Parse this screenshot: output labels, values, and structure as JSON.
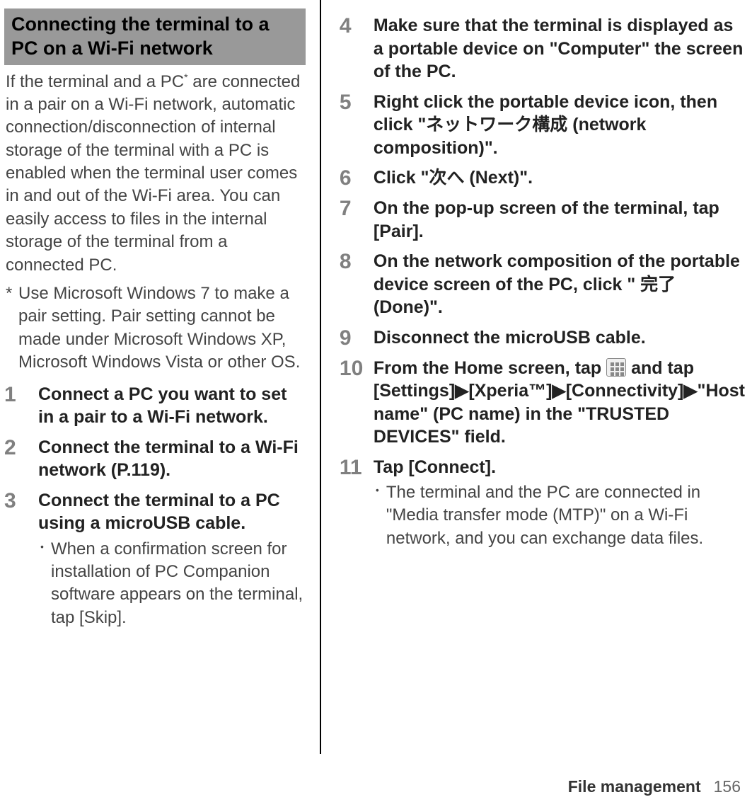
{
  "header": {
    "title": "Connecting the terminal to a PC on a Wi-Fi network"
  },
  "intro": {
    "text_before_ast": "If the terminal and a PC",
    "text_after_ast": " are connected in a pair on a Wi-Fi network, automatic connection/disconnection of internal storage of the terminal with a PC is enabled when the terminal user comes in and out of the Wi-Fi area. You can easily access to files in the internal storage of the terminal from a connected PC."
  },
  "footnote": {
    "marker": "*",
    "text": "Use Microsoft Windows 7 to make a pair setting. Pair setting cannot be made under Microsoft Windows XP, Microsoft Windows Vista or other OS."
  },
  "steps": [
    {
      "num": "1",
      "title": "Connect a PC you want to set in a pair to a Wi-Fi network."
    },
    {
      "num": "2",
      "title": "Connect the terminal to a Wi-Fi network (P.119)."
    },
    {
      "num": "3",
      "title": "Connect the terminal to a PC using a microUSB cable.",
      "sub": "When a confirmation screen for installation of PC Companion software appears on the terminal, tap [Skip]."
    },
    {
      "num": "4",
      "title": "Make sure that the terminal is displayed as a portable device on \"Computer\" the screen of the PC."
    },
    {
      "num": "5",
      "title": "Right click the portable device icon, then click \"ネットワーク構成 (network composition)\"."
    },
    {
      "num": "6",
      "title": "Click \"次へ (Next)\"."
    },
    {
      "num": "7",
      "title": "On the pop-up screen of the terminal, tap [Pair]."
    },
    {
      "num": "8",
      "title": "On the network composition of the portable device screen of the PC, click \" 完了 (Done)\"."
    },
    {
      "num": "9",
      "title": "Disconnect the microUSB cable."
    },
    {
      "num": "10",
      "title_pre": "From the Home screen, tap ",
      "title_post": " and tap [Settings]▶[Xperia™]▶[Connectivity]▶\"Host name\" (PC name) in the \"TRUSTED DEVICES\" field.",
      "has_icon": true
    },
    {
      "num": "11",
      "title": "Tap [Connect].",
      "sub": "The terminal and the PC are connected in \"Media transfer mode (MTP)\" on a Wi-Fi network, and you can exchange data files."
    }
  ],
  "footer": {
    "section": "File management",
    "page": "156"
  }
}
